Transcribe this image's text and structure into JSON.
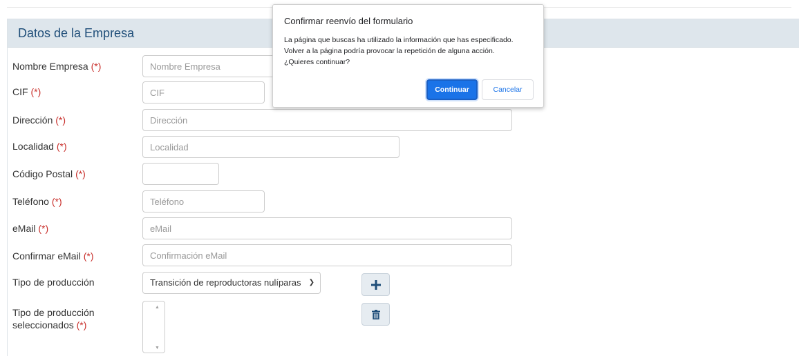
{
  "panel": {
    "title": "Datos de la Empresa"
  },
  "required_mark": "(*)",
  "form": {
    "nombre_empresa": {
      "label": "Nombre Empresa",
      "placeholder": "Nombre Empresa"
    },
    "cif": {
      "label": "CIF",
      "placeholder": "CIF"
    },
    "direccion": {
      "label": "Dirección",
      "placeholder": "Dirección"
    },
    "localidad": {
      "label": "Localidad",
      "placeholder": "Localidad"
    },
    "codigo_postal": {
      "label": "Código Postal",
      "placeholder": ""
    },
    "telefono": {
      "label": "Teléfono",
      "placeholder": "Teléfono"
    },
    "email": {
      "label": "eMail",
      "placeholder": "eMail"
    },
    "confirmar_email": {
      "label": "Confirmar eMail",
      "placeholder": "Confirmación eMail"
    },
    "tipo_produccion": {
      "label": "Tipo de producción",
      "selected": "Transición de reproductoras nulíparas"
    },
    "tipo_produccion_seleccionados": {
      "label_line1": "Tipo de producción",
      "label_line2": "seleccionados"
    }
  },
  "buttons": {
    "add_icon": "plus-icon",
    "delete_icon": "trash-icon"
  },
  "dialog": {
    "title": "Confirmar reenvío del formulario",
    "line1": "La página que buscas ha utilizado la información que has especificado.",
    "line2": "Volver a la página podría provocar la repetición de alguna acción.",
    "line3": "¿Quieres continuar?",
    "continue_label": "Continuar",
    "cancel_label": "Cancelar"
  },
  "colors": {
    "required": "#c9302c",
    "title": "#1f4e79",
    "primary": "#1a73e8"
  }
}
